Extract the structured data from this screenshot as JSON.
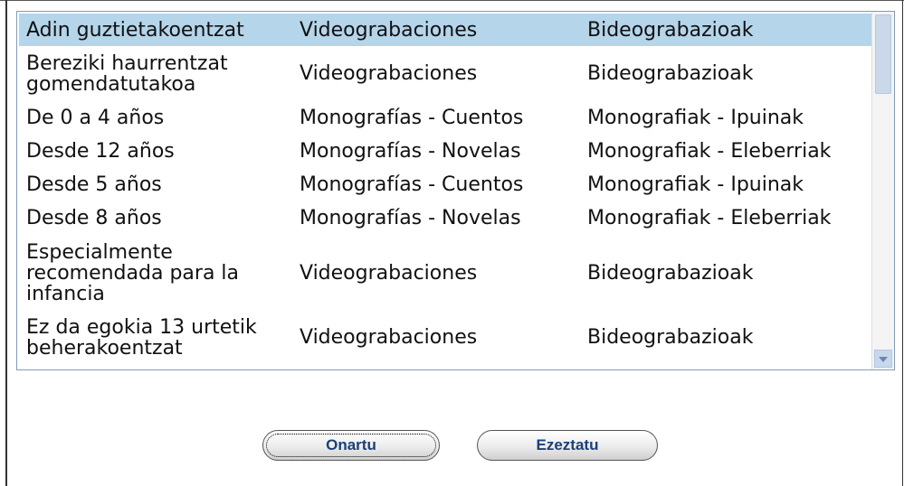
{
  "list": {
    "rows": [
      {
        "col1": "Adin guztietakoentzat",
        "col2": "Videograbaciones",
        "col3": "Bideograbazioak",
        "selected": true
      },
      {
        "col1": "Bereziki haurrentzat gomendatutakoa",
        "col2": "Videograbaciones",
        "col3": "Bideograbazioak",
        "selected": false
      },
      {
        "col1": "De 0 a 4 años",
        "col2": "Monografías - Cuentos",
        "col3": "Monografiak - Ipuinak",
        "selected": false
      },
      {
        "col1": "Desde 12 años",
        "col2": "Monografías - Novelas",
        "col3": "Monografiak - Eleberriak",
        "selected": false
      },
      {
        "col1": "Desde 5 años",
        "col2": "Monografías - Cuentos",
        "col3": "Monografiak - Ipuinak",
        "selected": false
      },
      {
        "col1": "Desde 8 años",
        "col2": "Monografías - Novelas",
        "col3": "Monografiak - Eleberriak",
        "selected": false
      },
      {
        "col1": "Especialmente recomendada para la infancia",
        "col2": "Videograbaciones",
        "col3": "Bideograbazioak",
        "selected": false
      },
      {
        "col1": "Ez da egokia 13 urtetik beherakoentzat",
        "col2": "Videograbaciones",
        "col3": "Bideograbazioak",
        "selected": false
      }
    ]
  },
  "buttons": {
    "ok_label": "Onartu",
    "cancel_label": "Ezeztatu"
  },
  "colors": {
    "selection": "#b5d5ea",
    "button_text": "#1a3f7a",
    "list_border": "#7f9db9"
  },
  "icons": {
    "scroll_down": "scroll-down-arrow-icon"
  }
}
